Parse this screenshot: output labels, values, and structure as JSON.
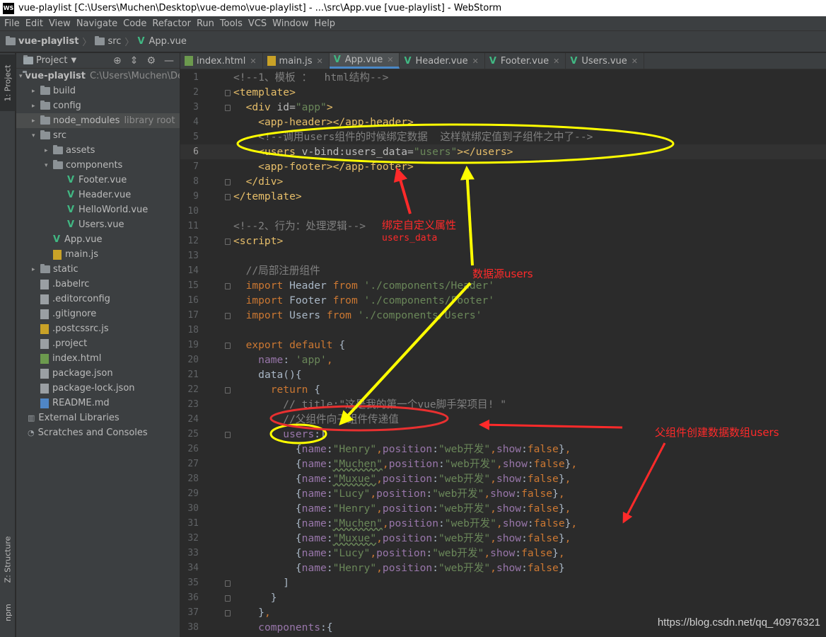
{
  "window": {
    "title": "vue-playlist [C:\\Users\\Muchen\\Desktop\\vue-demo\\vue-playlist] - ...\\src\\App.vue [vue-playlist] - WebStorm",
    "app_icon": "WS"
  },
  "menu": [
    "File",
    "Edit",
    "View",
    "Navigate",
    "Code",
    "Refactor",
    "Run",
    "Tools",
    "VCS",
    "Window",
    "Help"
  ],
  "breadcrumb": [
    "vue-playlist",
    "src",
    "App.vue"
  ],
  "left_tool_tabs": [
    "1: Project",
    "Z: Structure",
    "npm"
  ],
  "project_panel": {
    "title": "Project",
    "tree": [
      {
        "label": "vue-playlist",
        "meta": "C:\\Users\\Muchen\\De",
        "type": "folder",
        "arrow": "▾",
        "bold": true
      },
      {
        "label": "build",
        "type": "folder",
        "arrow": "▸"
      },
      {
        "label": "config",
        "type": "folder",
        "arrow": "▸"
      },
      {
        "label": "node_modules",
        "meta": "library root",
        "type": "folder",
        "arrow": "▸",
        "selected": true
      },
      {
        "label": "src",
        "type": "folder",
        "arrow": "▾"
      },
      {
        "label": "assets",
        "type": "folder",
        "arrow": "▸"
      },
      {
        "label": "components",
        "type": "folder",
        "arrow": "▾"
      },
      {
        "label": "Footer.vue",
        "type": "vue"
      },
      {
        "label": "Header.vue",
        "type": "vue"
      },
      {
        "label": "HelloWorld.vue",
        "type": "vue"
      },
      {
        "label": "Users.vue",
        "type": "vue"
      },
      {
        "label": "App.vue",
        "type": "vue"
      },
      {
        "label": "main.js",
        "type": "js"
      },
      {
        "label": "static",
        "type": "folder",
        "arrow": "▸"
      },
      {
        "label": ".babelrc",
        "type": "file"
      },
      {
        "label": ".editorconfig",
        "type": "file"
      },
      {
        "label": ".gitignore",
        "type": "file"
      },
      {
        "label": ".postcssrc.js",
        "type": "js"
      },
      {
        "label": ".project",
        "type": "file"
      },
      {
        "label": "index.html",
        "type": "html"
      },
      {
        "label": "package.json",
        "type": "file"
      },
      {
        "label": "package-lock.json",
        "type": "file"
      },
      {
        "label": "README.md",
        "type": "md"
      },
      {
        "label": "External Libraries",
        "type": "lib"
      },
      {
        "label": "Scratches and Consoles",
        "type": "scratch"
      }
    ]
  },
  "editor_tabs": [
    {
      "label": "index.html",
      "type": "html"
    },
    {
      "label": "main.js",
      "type": "js"
    },
    {
      "label": "App.vue",
      "type": "vue",
      "active": true
    },
    {
      "label": "Header.vue",
      "type": "vue"
    },
    {
      "label": "Footer.vue",
      "type": "vue"
    },
    {
      "label": "Users.vue",
      "type": "vue"
    }
  ],
  "current_line": 6,
  "code_lines": [
    [
      [
        "c-cmt",
        "<!--1、模板 ：  html结构-->"
      ]
    ],
    [
      [
        "c-tag",
        "<template>"
      ]
    ],
    [
      [
        "c-plain",
        "  "
      ],
      [
        "c-tag",
        "<div "
      ],
      [
        "c-attr",
        "id="
      ],
      [
        "c-str",
        "\"app\""
      ],
      [
        "c-tag",
        ">"
      ]
    ],
    [
      [
        "c-plain",
        "    "
      ],
      [
        "c-tag",
        "<app-header></app-header>"
      ]
    ],
    [
      [
        "c-plain",
        "    "
      ],
      [
        "c-cmt",
        "<!--调用users组件的时候绑定数据  这样就绑定值到子组件之中了-->"
      ]
    ],
    [
      [
        "c-plain",
        "    "
      ],
      [
        "c-tag",
        "<users "
      ],
      [
        "c-attr",
        "v-bind:users_data="
      ],
      [
        "c-str",
        "\"users\""
      ],
      [
        "c-tag",
        "></users>"
      ]
    ],
    [
      [
        "c-plain",
        "    "
      ],
      [
        "c-tag",
        "<app-footer></app-footer>"
      ]
    ],
    [
      [
        "c-plain",
        "  "
      ],
      [
        "c-tag",
        "</div>"
      ]
    ],
    [
      [
        "c-tag",
        "</template>"
      ]
    ],
    [],
    [
      [
        "c-cmt",
        "<!--2、行为：处理逻辑-->"
      ]
    ],
    [
      [
        "c-tag",
        "<script>"
      ]
    ],
    [],
    [
      [
        "c-plain",
        "  "
      ],
      [
        "c-cmt",
        "//局部注册组件"
      ]
    ],
    [
      [
        "c-plain",
        "  "
      ],
      [
        "c-kw",
        "import "
      ],
      [
        "c-plain",
        "Header "
      ],
      [
        "c-kw",
        "from "
      ],
      [
        "c-str",
        "'./components/Header'"
      ]
    ],
    [
      [
        "c-plain",
        "  "
      ],
      [
        "c-kw",
        "import "
      ],
      [
        "c-plain",
        "Footer "
      ],
      [
        "c-kw",
        "from "
      ],
      [
        "c-str",
        "'./components/Footer'"
      ]
    ],
    [
      [
        "c-plain",
        "  "
      ],
      [
        "c-kw",
        "import "
      ],
      [
        "c-plain",
        "Users "
      ],
      [
        "c-kw",
        "from "
      ],
      [
        "c-str",
        "'./components/Users'"
      ]
    ],
    [],
    [
      [
        "c-plain",
        "  "
      ],
      [
        "c-kw",
        "export default "
      ],
      [
        "c-plain",
        "{"
      ]
    ],
    [
      [
        "c-plain",
        "    "
      ],
      [
        "c-prop",
        "name"
      ],
      [
        "c-plain",
        ": "
      ],
      [
        "c-str",
        "'app'"
      ],
      [
        "c-kw",
        ","
      ]
    ],
    [
      [
        "c-plain",
        "    "
      ],
      [
        "c-plain",
        "data(){"
      ]
    ],
    [
      [
        "c-plain",
        "      "
      ],
      [
        "c-kw",
        "return "
      ],
      [
        "c-plain",
        "{"
      ]
    ],
    [
      [
        "c-plain",
        "        "
      ],
      [
        "c-cmt",
        "// title:\"这是我的第一个vue脚手架项目! \""
      ]
    ],
    [
      [
        "c-plain",
        "        "
      ],
      [
        "c-cmt",
        "//父组件向子组件传递值"
      ]
    ],
    [
      [
        "c-plain",
        "        "
      ],
      [
        "c-prop",
        "users"
      ],
      [
        "c-plain",
        ":["
      ]
    ],
    [
      [
        "c-plain",
        "          {"
      ],
      [
        "c-prop",
        "name"
      ],
      [
        "c-plain",
        ":"
      ],
      [
        "c-str",
        "\"Henry\""
      ],
      [
        "c-kw",
        ","
      ],
      [
        "c-prop",
        "position"
      ],
      [
        "c-plain",
        ":"
      ],
      [
        "c-str",
        "\"web开发\""
      ],
      [
        "c-kw",
        ","
      ],
      [
        "c-prop",
        "show"
      ],
      [
        "c-plain",
        ":"
      ],
      [
        "c-kw",
        "false"
      ],
      [
        "c-plain",
        "}"
      ],
      [
        "c-kw",
        ","
      ]
    ],
    [
      [
        "c-plain",
        "          {"
      ],
      [
        "c-prop",
        "name"
      ],
      [
        "c-plain",
        ":"
      ],
      [
        "c-str c-squig",
        "\"Muchen\""
      ],
      [
        "c-kw",
        ","
      ],
      [
        "c-prop",
        "position"
      ],
      [
        "c-plain",
        ":"
      ],
      [
        "c-str",
        "\"web开发\""
      ],
      [
        "c-kw",
        ","
      ],
      [
        "c-prop",
        "show"
      ],
      [
        "c-plain",
        ":"
      ],
      [
        "c-kw",
        "false"
      ],
      [
        "c-plain",
        "}"
      ],
      [
        "c-kw",
        ","
      ]
    ],
    [
      [
        "c-plain",
        "          {"
      ],
      [
        "c-prop",
        "name"
      ],
      [
        "c-plain",
        ":"
      ],
      [
        "c-str c-squig",
        "\"Muxue\""
      ],
      [
        "c-kw",
        ","
      ],
      [
        "c-prop",
        "position"
      ],
      [
        "c-plain",
        ":"
      ],
      [
        "c-str",
        "\"web开发\""
      ],
      [
        "c-kw",
        ","
      ],
      [
        "c-prop",
        "show"
      ],
      [
        "c-plain",
        ":"
      ],
      [
        "c-kw",
        "false"
      ],
      [
        "c-plain",
        "}"
      ],
      [
        "c-kw",
        ","
      ]
    ],
    [
      [
        "c-plain",
        "          {"
      ],
      [
        "c-prop",
        "name"
      ],
      [
        "c-plain",
        ":"
      ],
      [
        "c-str",
        "\"Lucy\""
      ],
      [
        "c-kw",
        ","
      ],
      [
        "c-prop",
        "position"
      ],
      [
        "c-plain",
        ":"
      ],
      [
        "c-str",
        "\"web开发\""
      ],
      [
        "c-kw",
        ","
      ],
      [
        "c-prop",
        "show"
      ],
      [
        "c-plain",
        ":"
      ],
      [
        "c-kw",
        "false"
      ],
      [
        "c-plain",
        "}"
      ],
      [
        "c-kw",
        ","
      ]
    ],
    [
      [
        "c-plain",
        "          {"
      ],
      [
        "c-prop",
        "name"
      ],
      [
        "c-plain",
        ":"
      ],
      [
        "c-str",
        "\"Henry\""
      ],
      [
        "c-kw",
        ","
      ],
      [
        "c-prop",
        "position"
      ],
      [
        "c-plain",
        ":"
      ],
      [
        "c-str",
        "\"web开发\""
      ],
      [
        "c-kw",
        ","
      ],
      [
        "c-prop",
        "show"
      ],
      [
        "c-plain",
        ":"
      ],
      [
        "c-kw",
        "false"
      ],
      [
        "c-plain",
        "}"
      ],
      [
        "c-kw",
        ","
      ]
    ],
    [
      [
        "c-plain",
        "          {"
      ],
      [
        "c-prop",
        "name"
      ],
      [
        "c-plain",
        ":"
      ],
      [
        "c-str c-squig",
        "\"Muchen\""
      ],
      [
        "c-kw",
        ","
      ],
      [
        "c-prop",
        "position"
      ],
      [
        "c-plain",
        ":"
      ],
      [
        "c-str",
        "\"web开发\""
      ],
      [
        "c-kw",
        ","
      ],
      [
        "c-prop",
        "show"
      ],
      [
        "c-plain",
        ":"
      ],
      [
        "c-kw",
        "false"
      ],
      [
        "c-plain",
        "}"
      ],
      [
        "c-kw",
        ","
      ]
    ],
    [
      [
        "c-plain",
        "          {"
      ],
      [
        "c-prop",
        "name"
      ],
      [
        "c-plain",
        ":"
      ],
      [
        "c-str c-squig",
        "\"Muxue\""
      ],
      [
        "c-kw",
        ","
      ],
      [
        "c-prop",
        "position"
      ],
      [
        "c-plain",
        ":"
      ],
      [
        "c-str",
        "\"web开发\""
      ],
      [
        "c-kw",
        ","
      ],
      [
        "c-prop",
        "show"
      ],
      [
        "c-plain",
        ":"
      ],
      [
        "c-kw",
        "false"
      ],
      [
        "c-plain",
        "}"
      ],
      [
        "c-kw",
        ","
      ]
    ],
    [
      [
        "c-plain",
        "          {"
      ],
      [
        "c-prop",
        "name"
      ],
      [
        "c-plain",
        ":"
      ],
      [
        "c-str",
        "\"Lucy\""
      ],
      [
        "c-kw",
        ","
      ],
      [
        "c-prop",
        "position"
      ],
      [
        "c-plain",
        ":"
      ],
      [
        "c-str",
        "\"web开发\""
      ],
      [
        "c-kw",
        ","
      ],
      [
        "c-prop",
        "show"
      ],
      [
        "c-plain",
        ":"
      ],
      [
        "c-kw",
        "false"
      ],
      [
        "c-plain",
        "}"
      ],
      [
        "c-kw",
        ","
      ]
    ],
    [
      [
        "c-plain",
        "          {"
      ],
      [
        "c-prop",
        "name"
      ],
      [
        "c-plain",
        ":"
      ],
      [
        "c-str",
        "\"Henry\""
      ],
      [
        "c-kw",
        ","
      ],
      [
        "c-prop",
        "position"
      ],
      [
        "c-plain",
        ":"
      ],
      [
        "c-str",
        "\"web开发\""
      ],
      [
        "c-kw",
        ","
      ],
      [
        "c-prop",
        "show"
      ],
      [
        "c-plain",
        ":"
      ],
      [
        "c-kw",
        "false"
      ],
      [
        "c-plain",
        "}"
      ]
    ],
    [
      [
        "c-plain",
        "        ]"
      ]
    ],
    [
      [
        "c-plain",
        "      }"
      ]
    ],
    [
      [
        "c-plain",
        "    }"
      ],
      [
        "c-kw",
        ","
      ]
    ],
    [
      [
        "c-plain",
        "    "
      ],
      [
        "c-prop",
        "components"
      ],
      [
        "c-plain",
        ":{"
      ]
    ]
  ],
  "annotations": {
    "bind_attr": "绑定自定义属性",
    "bind_attr_sub": "users_data",
    "data_source": "数据源users",
    "parent_array": "父组件创建数据数组users"
  },
  "colors": {
    "highlight_yellow": "#ffff00",
    "annotation_red": "#ff2a2a"
  },
  "watermark": "https://blog.csdn.net/qq_40976321"
}
